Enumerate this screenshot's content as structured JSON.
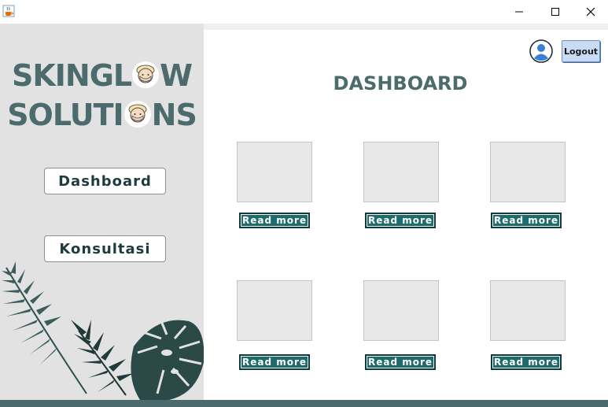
{
  "window": {
    "icon": "java-cup-icon",
    "controls": [
      "minimize-icon",
      "maximize-icon",
      "close-icon"
    ]
  },
  "brand": {
    "line1_a": "SKINGL",
    "line1_b": "W",
    "line2_a": "SOLUTI",
    "line2_b": "NS",
    "logo_icon": "face-mask-logo"
  },
  "nav": {
    "dashboard_label": "Dashboard",
    "konsultasi_label": "Konsultasi"
  },
  "header": {
    "profile_icon": "user-avatar-icon",
    "logout_label": "Logout"
  },
  "main": {
    "title": "DASHBOARD",
    "cards": [
      {
        "button": "Read more"
      },
      {
        "button": "Read more"
      },
      {
        "button": "Read more"
      },
      {
        "button": "Read more"
      },
      {
        "button": "Read more"
      },
      {
        "button": "Read more"
      }
    ]
  },
  "colors": {
    "brand": "#4c6b6d",
    "button_teal": "#1d6b6b",
    "sidebar_bg": "#e2e2e2",
    "bottom_bar": "#4b6a6b",
    "logout_bg": "#c9dcf3"
  }
}
